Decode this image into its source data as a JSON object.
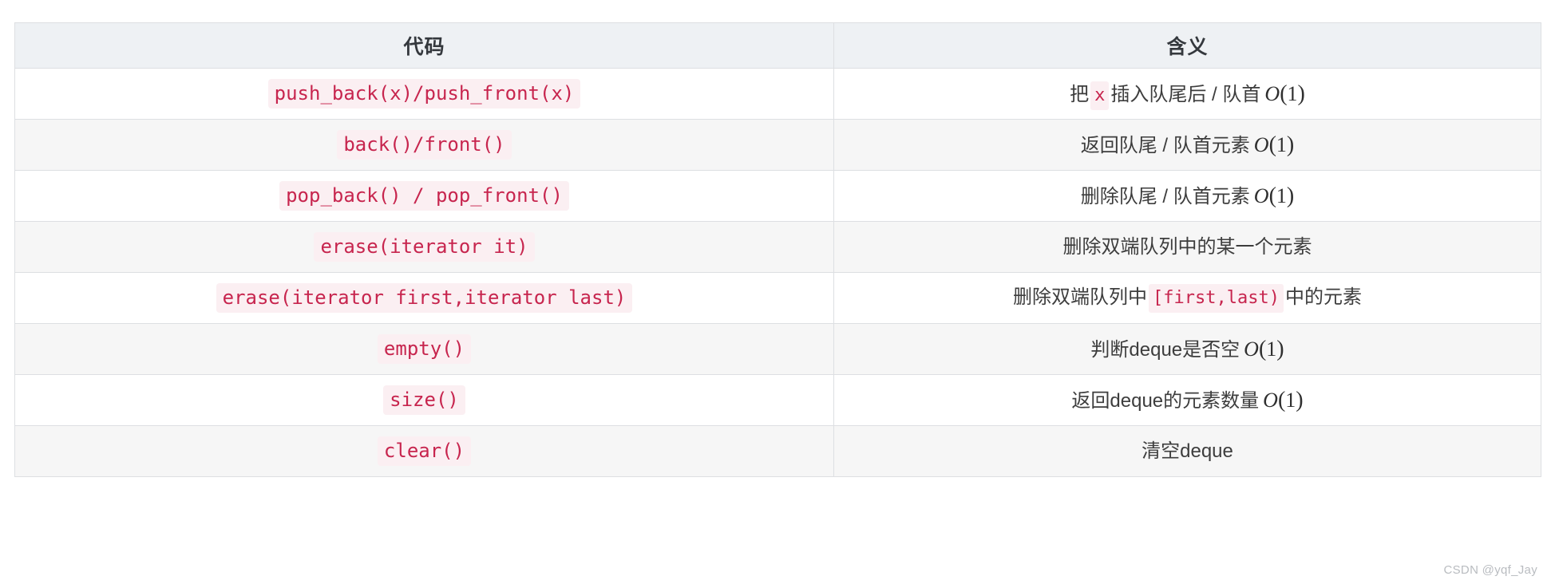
{
  "table": {
    "headers": {
      "code": "代码",
      "meaning": "含义"
    },
    "rows": [
      {
        "code": "push_back(x)/push_front(x)",
        "meaning_prefix": "把",
        "meaning_inline_code": "x",
        "meaning_suffix": "插入队尾后 / 队首",
        "complexity": "O(1)"
      },
      {
        "code": "back()/front()",
        "meaning_prefix": "返回队尾 / 队首元素",
        "meaning_inline_code": "",
        "meaning_suffix": "",
        "complexity": "O(1)"
      },
      {
        "code": "pop_back() / pop_front()",
        "meaning_prefix": "删除队尾 / 队首元素",
        "meaning_inline_code": "",
        "meaning_suffix": "",
        "complexity": "O(1)"
      },
      {
        "code": "erase(iterator it)",
        "meaning_prefix": "删除双端队列中的某一个元素",
        "meaning_inline_code": "",
        "meaning_suffix": "",
        "complexity": ""
      },
      {
        "code": "erase(iterator first,iterator last)",
        "meaning_prefix": "删除双端队列中",
        "meaning_inline_code": "[first,last)",
        "meaning_suffix": "中的元素",
        "complexity": ""
      },
      {
        "code": "empty()",
        "meaning_prefix": "判断deque是否空",
        "meaning_inline_code": "",
        "meaning_suffix": "",
        "complexity": "O(1)"
      },
      {
        "code": "size()",
        "meaning_prefix": "返回deque的元素数量",
        "meaning_inline_code": "",
        "meaning_suffix": "",
        "complexity": "O(1)"
      },
      {
        "code": "clear()",
        "meaning_prefix": "清空deque",
        "meaning_inline_code": "",
        "meaning_suffix": "",
        "complexity": ""
      }
    ]
  },
  "watermark": "CSDN @yqf_Jay",
  "colors": {
    "header_background": "#eef1f4",
    "stripe_background": "#f6f6f6",
    "border": "#dddfe2",
    "code_text": "#c7254e",
    "code_background": "#fbeff2",
    "body_text": "#3f3f3f",
    "watermark_text": "#b9bcc0"
  }
}
